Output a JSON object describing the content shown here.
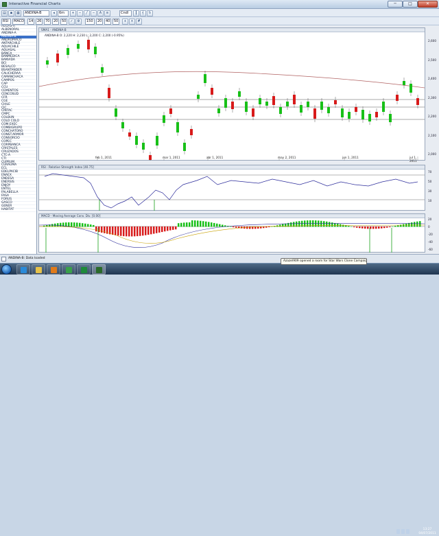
{
  "window": {
    "title": "Interactive Financial Charts",
    "min_glyph": "─",
    "max_glyph": "□",
    "close_glyph": "✕"
  },
  "toolbar1": {
    "symbol": "ANDINA-B",
    "period": "6m",
    "style": "Cndl"
  },
  "toolbar2": {
    "indicator1": "RSI",
    "indicator2": "MACD",
    "params": [
      "14",
      "26",
      "70",
      "20",
      "50",
      "150",
      "20",
      "40",
      "50"
    ]
  },
  "sidebar": {
    "items": [
      "AGUAS-A",
      "ALBENORAL",
      "ANDINA-A",
      "ANDINA-B",
      "ANDROMACO",
      "ANTARCHILE",
      "AQUACHILE",
      "AQUASAL",
      "BANCA",
      "BANMEDICA",
      "BANVIDA",
      "BCI",
      "BESALCO",
      "BSANTANDER",
      "CALICHERAA",
      "CAMANCHACA",
      "CAMPOS",
      "CAP",
      "CCU",
      "CEMENTOS",
      "CENCOSUD",
      "CFR",
      "CGE",
      "CHILE",
      "CIC",
      "CINTAC",
      "CMPC",
      "COLBUN",
      "COLO COLO",
      "COM.EXEC",
      "COMBIGRUPO",
      "CONCHATORO",
      "CONST.ARMOR",
      "CONSORCIO",
      "COPEC",
      "CORPBANCA",
      "CRISTALES",
      "CRUZADOS",
      "CTC-A",
      "CTI",
      "CUPRUM",
      "CURAUMA",
      "ECL",
      "EDELPACIB",
      "ENAEX",
      "ENDESA",
      "ENERSIS",
      "ENJOY",
      "ENTEL",
      "FALABELLA",
      "FASA",
      "FORUS",
      "GASCO",
      "GENER",
      "HABITAT"
    ],
    "selected_index": 3
  },
  "price_panel": {
    "legend": "SMA1 - ANDINA-B",
    "info": "ANDINA-B  O: 2,220  H: 2,230  L: 2,200  C: 2,200 (-0.95%)",
    "axis_ticks": [
      "2,600",
      "2,500",
      "2,400",
      "2,300",
      "2,200",
      "2,100",
      "2,000"
    ],
    "date_labels": [
      "feb 1, 2011",
      "mar 1, 2011",
      "abr 1, 2011",
      "may 2, 2011",
      "jun 1, 2011",
      "jul 1, 2011"
    ]
  },
  "rsi_panel": {
    "title": "RSI - Relative Strength Index [40.75]",
    "axis_ticks": [
      "70",
      "50",
      "30",
      "10"
    ]
  },
  "macd_panel": {
    "title": "MACD - Moving Average Conv. Div. [0.00]",
    "axis_ticks": [
      "20",
      "0",
      "-20",
      "-40",
      "-60"
    ]
  },
  "status": {
    "text": "ANDINA-B: Data loaded"
  },
  "taskbar": {
    "toast": "Azazel909 opened a room for Star Wars Clone Campaigns",
    "time": "13:27",
    "date": "04/07/2011"
  },
  "colors": {
    "up": "#18c018",
    "down": "#d81a1a",
    "sma": "#b06060",
    "rsi": "#2a2a9a",
    "macd_signal": "#c8a000"
  }
}
